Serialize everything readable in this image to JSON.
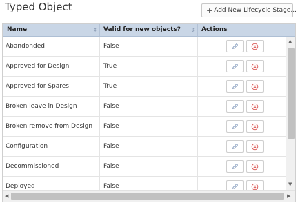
{
  "header": {
    "title": "Typed Object",
    "add_button_label": "Add New Lifecycle Stage..."
  },
  "table": {
    "columns": [
      "Name",
      "Valid for new objects?",
      "Actions"
    ],
    "rows": [
      {
        "name": "Abandonded",
        "valid": "False"
      },
      {
        "name": "Approved for Design",
        "valid": "True"
      },
      {
        "name": "Approved for Spares",
        "valid": "True"
      },
      {
        "name": "Broken leave in Design",
        "valid": "False"
      },
      {
        "name": "Broken remove from Design",
        "valid": "False"
      },
      {
        "name": "Configuration",
        "valid": "False"
      },
      {
        "name": "Decommissioned",
        "valid": "False"
      },
      {
        "name": "Deployed",
        "valid": "False"
      }
    ]
  },
  "icons": {
    "add": "plus-icon",
    "edit": "pencil-icon",
    "delete": "circle-x-icon",
    "sort": "sort-icon"
  },
  "colors": {
    "header_bg": "#c9d6e6",
    "delete_icon": "#d9534f",
    "edit_icon": "#8aa0c0"
  }
}
